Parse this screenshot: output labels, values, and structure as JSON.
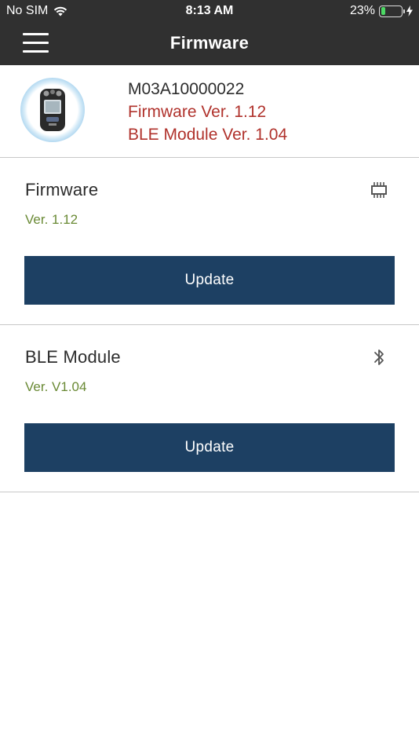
{
  "status_bar": {
    "carrier": "No SIM",
    "time": "8:13 AM",
    "battery_percent": "23%",
    "battery_level": 0.23,
    "battery_color": "#4cd964",
    "wifi_icon": "wifi-icon",
    "charging_icon": "charging-bolt-icon"
  },
  "nav": {
    "menu_icon": "hamburger-menu-icon",
    "title": "Firmware"
  },
  "device": {
    "image": "gas-detector-device-image",
    "serial": "M03A10000022",
    "firmware_version": "Firmware Ver. 1.12",
    "ble_version": "BLE Module Ver. 1.04"
  },
  "sections": {
    "firmware": {
      "title": "Firmware",
      "version": "Ver. 1.12",
      "icon": "chip-icon",
      "button_label": "Update"
    },
    "ble": {
      "title": "BLE Module",
      "version": "Ver. V1.04",
      "icon": "bluetooth-icon",
      "button_label": "Update"
    }
  },
  "colors": {
    "nav_background": "#303030",
    "button_background": "#1d4063",
    "version_text": "#6a8a35",
    "device_highlight_text": "#b0322c"
  }
}
